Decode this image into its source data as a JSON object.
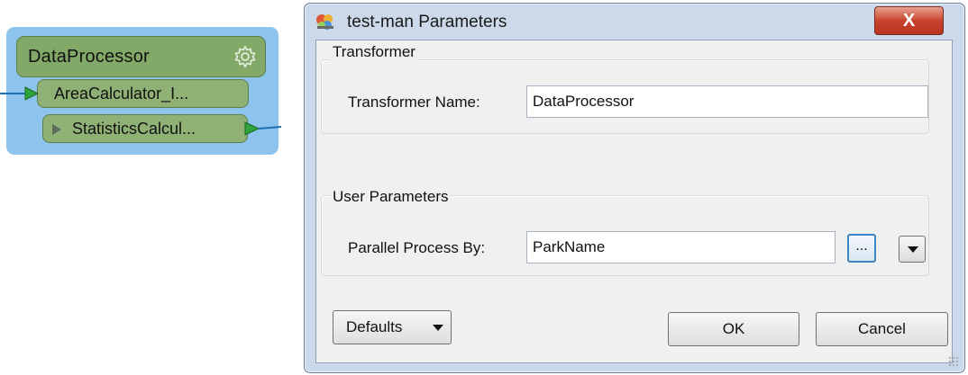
{
  "node": {
    "title": "DataProcessor",
    "input_port_label": "AreaCalculator_I...",
    "output_port_label": "StatisticsCalcul...",
    "icons": {
      "settings": "gear-icon",
      "input": "input-arrow-icon",
      "output": "output-arrow-icon",
      "expand": "play-icon"
    },
    "colors": {
      "bookmark": "#8dc4ee",
      "header": "#82a967",
      "port": "#8fb176",
      "connector": "#2e8b2e"
    }
  },
  "dialog": {
    "title": "test-man Parameters",
    "close_label": "X",
    "transformer_group": {
      "title": "Transformer",
      "name_label": "Transformer Name:",
      "name_value": "DataProcessor"
    },
    "user_group": {
      "title": "User Parameters",
      "parallel_label": "Parallel Process By:",
      "parallel_value": "ParkName",
      "browse_label": "..."
    },
    "buttons": {
      "defaults": "Defaults",
      "ok": "OK",
      "cancel": "Cancel"
    },
    "colors": {
      "frame": "#cbd9ea",
      "close": "#c8442e",
      "focus": "#3d86c4"
    }
  }
}
